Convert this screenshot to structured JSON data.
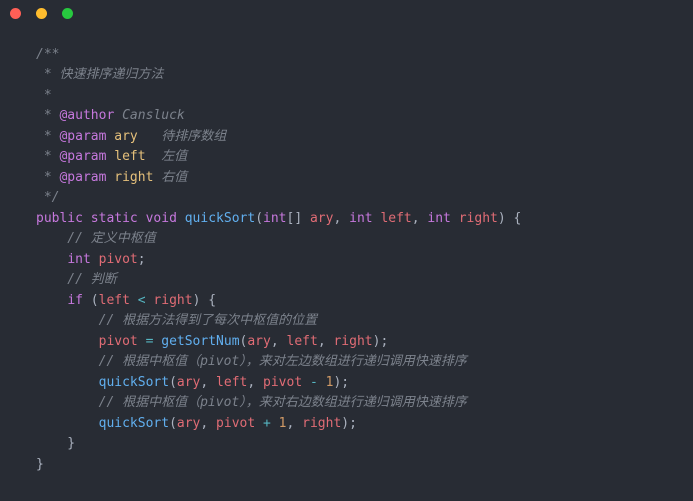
{
  "titlebar": {
    "dots": [
      "close",
      "minimize",
      "zoom"
    ]
  },
  "code": {
    "c1": "/**",
    "c2": " * 快速排序递归方法",
    "c3": " *",
    "c4a": " * ",
    "c4b": "@author",
    "c4c": " Cansluck",
    "c5a": " * ",
    "c5b": "@param",
    "c5c": " ",
    "c5d": "ary",
    "c5e": "   待排序数组",
    "c6a": " * ",
    "c6b": "@param",
    "c6c": " ",
    "c6d": "left",
    "c6e": "  左值",
    "c7a": " * ",
    "c7b": "@param",
    "c7c": " ",
    "c7d": "right",
    "c7e": " 右值",
    "c8": " */",
    "l9": {
      "kw1": "public",
      "kw2": "static",
      "kw3": "void",
      "fn": "quickSort",
      "po": "(",
      "t1": "int",
      "arr": "[] ",
      "p1": "ary",
      "cm1": ", ",
      "t2": "int",
      "sp2": " ",
      "p2": "left",
      "cm2": ", ",
      "t3": "int",
      "sp3": " ",
      "p3": "right",
      "pc": ")",
      "sp4": " ",
      "br": "{"
    },
    "l10": "    // 定义中枢值",
    "l11": {
      "pad": "    ",
      "t": "int",
      "sp": " ",
      "v": "pivot",
      "sc": ";"
    },
    "l12": "    // 判断",
    "l13": {
      "pad": "    ",
      "kw": "if",
      "sp": " ",
      "po": "(",
      "a": "left",
      "sp2": " ",
      "op": "<",
      "sp3": " ",
      "b": "right",
      "pc": ")",
      "sp4": " ",
      "br": "{"
    },
    "l14": "        // 根据方法得到了每次中枢值的位置",
    "l15": {
      "pad": "        ",
      "v": "pivot",
      "sp": " ",
      "eq": "=",
      "sp2": " ",
      "fn": "getSortNum",
      "po": "(",
      "a": "ary",
      "cm1": ", ",
      "b": "left",
      "cm2": ", ",
      "c": "right",
      "pc": ")",
      "sc": ";"
    },
    "l16": "        // 根据中枢值（pivot），来对左边数组进行递归调用快速排序",
    "l17": {
      "pad": "        ",
      "fn": "quickSort",
      "po": "(",
      "a": "ary",
      "cm1": ", ",
      "b": "left",
      "cm2": ", ",
      "c": "pivot",
      "sp": " ",
      "op": "-",
      "sp2": " ",
      "n": "1",
      "pc": ")",
      "sc": ";"
    },
    "l18": "        // 根据中枢值（pivot），来对右边数组进行递归调用快速排序",
    "l19": {
      "pad": "        ",
      "fn": "quickSort",
      "po": "(",
      "a": "ary",
      "cm1": ", ",
      "b": "pivot",
      "sp": " ",
      "op": "+",
      "sp2": " ",
      "n": "1",
      "cm2": ", ",
      "c": "right",
      "pc": ")",
      "sc": ";"
    },
    "l20": "    }",
    "l21": "}"
  }
}
